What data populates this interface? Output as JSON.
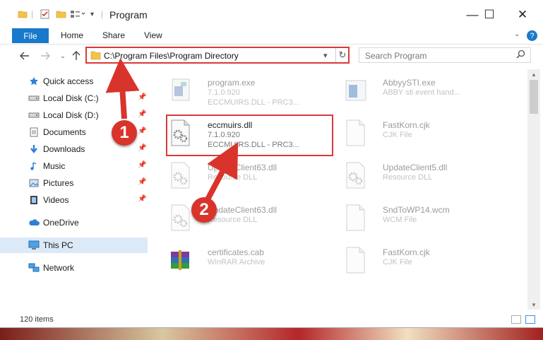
{
  "window": {
    "title": "Program",
    "controls": {
      "minimize": "—",
      "maximize": "☐",
      "close": "✕"
    }
  },
  "ribbon": {
    "tabs": [
      "File",
      "Home",
      "Share",
      "View"
    ],
    "help": "?"
  },
  "address_bar": {
    "path": "C:\\Program Files\\Program Directory",
    "dropdown": "▾",
    "refresh": "↻"
  },
  "search": {
    "placeholder": "Search Program",
    "icon": "search-icon"
  },
  "navigation": [
    {
      "label": "Quick access",
      "icon": "star-icon",
      "pinned": false,
      "selected": false
    },
    {
      "label": "Local Disk (C:)",
      "icon": "drive-icon",
      "pinned": true,
      "selected": false
    },
    {
      "label": "Local Disk (D:)",
      "icon": "drive-icon",
      "pinned": true,
      "selected": false
    },
    {
      "label": "Documents",
      "icon": "documents-icon",
      "pinned": true,
      "selected": false
    },
    {
      "label": "Downloads",
      "icon": "downloads-icon",
      "pinned": true,
      "selected": false
    },
    {
      "label": "Music",
      "icon": "music-icon",
      "pinned": true,
      "selected": false
    },
    {
      "label": "Pictures",
      "icon": "pictures-icon",
      "pinned": true,
      "selected": false
    },
    {
      "label": "Videos",
      "icon": "videos-icon",
      "pinned": true,
      "selected": false
    },
    {
      "label": "OneDrive",
      "icon": "cloud-icon",
      "pinned": false,
      "selected": false
    },
    {
      "label": "This PC",
      "icon": "computer-icon",
      "pinned": false,
      "selected": true
    },
    {
      "label": "Network",
      "icon": "network-icon",
      "pinned": false,
      "selected": false
    }
  ],
  "files": [
    {
      "name": "program.exe",
      "line1": "7.1.0.920",
      "line2": "ECCMUIRS.DLL - PRC3...",
      "icon": "exe-icon",
      "faded": true
    },
    {
      "name": "AbbyySTI.exe",
      "line1": "ABBY sti event hand...",
      "line2": "",
      "icon": "exe-icon",
      "faded": true
    },
    {
      "name": "eccmuirs.dll",
      "line1": "7.1.0.920",
      "line2": "ECCMUIRS.DLL - PRC3...",
      "icon": "dll-gear-icon",
      "faded": false
    },
    {
      "name": "FastKorn.cjk",
      "line1": "CJK File",
      "line2": "",
      "icon": "blank-file-icon",
      "faded": true
    },
    {
      "name": "UpdateClient63.dll",
      "line1": "Resource DLL",
      "line2": "",
      "icon": "dll-gear-icon",
      "faded": true
    },
    {
      "name": "UpdateClient5.dll",
      "line1": "Resource DLL",
      "line2": "",
      "icon": "dll-gear-icon",
      "faded": true
    },
    {
      "name": "UpdateClient63.dll",
      "line1": "Resource DLL",
      "line2": "",
      "icon": "dll-gear-icon",
      "faded": true
    },
    {
      "name": "SndToWP14.wcm",
      "line1": "WCM File",
      "line2": "",
      "icon": "blank-file-icon",
      "faded": true
    },
    {
      "name": "certificates.cab",
      "line1": "WinRAR Archive",
      "line2": "",
      "icon": "archive-icon",
      "faded": true
    },
    {
      "name": "FastKorn.cjk",
      "line1": "CJK File",
      "line2": "",
      "icon": "blank-file-icon",
      "faded": true
    }
  ],
  "status": {
    "item_count": "120 items"
  },
  "annotations": {
    "step1": "1",
    "step2": "2",
    "color": "#d9342b"
  },
  "colors": {
    "accent": "#1979ca",
    "highlight": "#d93a3a",
    "selected_bg": "#dce9f7"
  }
}
